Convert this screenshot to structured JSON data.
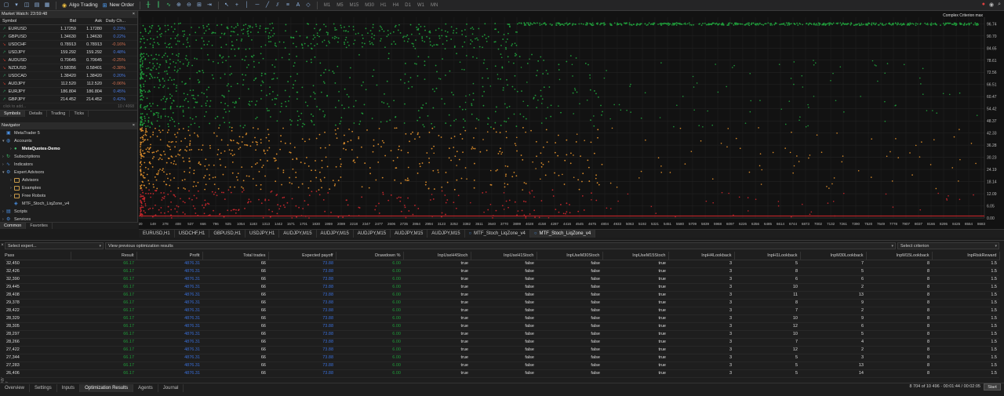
{
  "toolbar": {
    "algo_trading": "Algo Trading",
    "new_order": "New Order",
    "timeframes": [
      "M1",
      "M5",
      "M15",
      "M30",
      "H1",
      "H4",
      "D1",
      "W1",
      "MN"
    ]
  },
  "market_watch": {
    "title": "Market Watch: 23:59:48",
    "columns": [
      "Symbol",
      "Bid",
      "Ask",
      "Daily Ch..."
    ],
    "rows": [
      {
        "symbol": "EURUSD",
        "dir": "up",
        "bid": "1.17259",
        "ask": "1.17280",
        "chg": "0.23%",
        "chg_dir": "up"
      },
      {
        "symbol": "GBPUSD",
        "dir": "up",
        "bid": "1.34630",
        "ask": "1.34630",
        "chg": "0.22%",
        "chg_dir": "up"
      },
      {
        "symbol": "USDCHF",
        "dir": "dn",
        "bid": "0.78913",
        "ask": "0.78913",
        "chg": "-0.16%",
        "chg_dir": "dn"
      },
      {
        "symbol": "USDJPY",
        "dir": "up",
        "bid": "159.292",
        "ask": "159.292",
        "chg": "0.48%",
        "chg_dir": "up"
      },
      {
        "symbol": "AUDUSD",
        "dir": "dn",
        "bid": "0.70645",
        "ask": "0.70645",
        "chg": "-0.25%",
        "chg_dir": "dn"
      },
      {
        "symbol": "NZDUSD",
        "dir": "dn",
        "bid": "0.58356",
        "ask": "0.58401",
        "chg": "-0.38%",
        "chg_dir": "dn"
      },
      {
        "symbol": "USDCAD",
        "dir": "up",
        "bid": "1.38420",
        "ask": "1.38420",
        "chg": "0.20%",
        "chg_dir": "up"
      },
      {
        "symbol": "AUDJPY",
        "dir": "dn",
        "bid": "112.520",
        "ask": "112.520",
        "chg": "-0.06%",
        "chg_dir": "dn"
      },
      {
        "symbol": "EURJPY",
        "dir": "up",
        "bid": "186.804",
        "ask": "186.804",
        "chg": "0.45%",
        "chg_dir": "up"
      },
      {
        "symbol": "GBPJPY",
        "dir": "up",
        "bid": "214.452",
        "ask": "214.452",
        "chg": "0.42%",
        "chg_dir": "up"
      }
    ],
    "footer_left": "click to add...",
    "footer_right": "10 / 4068",
    "tabs": [
      "Symbols",
      "Details",
      "Trading",
      "Ticks"
    ]
  },
  "navigator": {
    "title": "Navigator",
    "items": [
      {
        "label": "MetaTrader 5",
        "level": 0,
        "arrow": "",
        "icon": "terminal-icon"
      },
      {
        "label": "Accounts",
        "level": 0,
        "arrow": "▾",
        "icon": "accounts-icon"
      },
      {
        "label": "MetaQuotes-Demo",
        "level": 1,
        "arrow": "›",
        "icon": "account-icon",
        "bold": true
      },
      {
        "label": "Subscriptions",
        "level": 0,
        "arrow": "›",
        "icon": "subscriptions-icon"
      },
      {
        "label": "Indicators",
        "level": 0,
        "arrow": "›",
        "icon": "indicators-icon"
      },
      {
        "label": "Expert Advisors",
        "level": 0,
        "arrow": "▾",
        "icon": "expert-advisors-icon"
      },
      {
        "label": "Advisors",
        "level": 1,
        "arrow": "›",
        "icon": "folder-icon"
      },
      {
        "label": "Examples",
        "level": 1,
        "arrow": "›",
        "icon": "folder-icon"
      },
      {
        "label": "Free Robots",
        "level": 1,
        "arrow": "›",
        "icon": "folder-icon"
      },
      {
        "label": "MTF_Stoch_LiqZone_v4",
        "level": 1,
        "arrow": "",
        "icon": "expert-icon"
      },
      {
        "label": "Scripts",
        "level": 0,
        "arrow": "›",
        "icon": "scripts-icon"
      },
      {
        "label": "Services",
        "level": 0,
        "arrow": "›",
        "icon": "services-icon"
      }
    ],
    "tabs": [
      "Common",
      "Favorites"
    ]
  },
  "chart": {
    "legend": "Complex Criterion max",
    "y_ticks": [
      "96.74",
      "90.70",
      "84.65",
      "78.61",
      "72.56",
      "66.51",
      "60.47",
      "54.42",
      "48.37",
      "42.33",
      "36.28",
      "30.23",
      "24.19",
      "18.14",
      "12.09",
      "6.05",
      "0.00"
    ],
    "x_ticks": [
      "20",
      "149",
      "278",
      "408",
      "537",
      "666",
      "796",
      "925",
      "1054",
      "1183",
      "1313",
      "1442",
      "1571",
      "1701",
      "1830",
      "1959",
      "2089",
      "2218",
      "2347",
      "2477",
      "2606",
      "2735",
      "2864",
      "2994",
      "3123",
      "3252",
      "3382",
      "3511",
      "3640",
      "3770",
      "3899",
      "4028",
      "4158",
      "4287",
      "4416",
      "4545",
      "4675",
      "4804",
      "4933",
      "5063",
      "5192",
      "5321",
      "5451",
      "5580",
      "5709",
      "5839",
      "5968",
      "6097",
      "6226",
      "6356",
      "6485",
      "6614",
      "6744",
      "6873",
      "7002",
      "7132",
      "7261",
      "7390",
      "7520",
      "7649",
      "7778",
      "7907",
      "8037",
      "8166",
      "8295",
      "8425",
      "8554",
      "8683"
    ],
    "y_range": [
      0,
      100
    ],
    "x_range": [
      20,
      8683
    ]
  },
  "chart_tabs": [
    {
      "label": "EURUSD,H1",
      "icon": ""
    },
    {
      "label": "USDCHF,H1",
      "icon": ""
    },
    {
      "label": "GBPUSD,H1",
      "icon": ""
    },
    {
      "label": "USDJPY,H1",
      "icon": ""
    },
    {
      "label": "AUDJPY,M15",
      "icon": ""
    },
    {
      "label": "AUDJPY,M15",
      "icon": ""
    },
    {
      "label": "AUDJPY,M15",
      "icon": ""
    },
    {
      "label": "AUDJPY,M15",
      "icon": ""
    },
    {
      "label": "AUDJPY,M15",
      "icon": ""
    },
    {
      "label": "MTF_Stoch_LiqZone_v4",
      "icon": "○"
    },
    {
      "label": "MTF_Stoch_LiqZone_v4",
      "icon": "○",
      "active": true
    }
  ],
  "optimization": {
    "select_expert": "Select expert...",
    "view_results": "View previous optimization results",
    "select_criterion": "Select criterion",
    "columns": [
      "Pass",
      "Result",
      "Profit",
      "Total trades",
      "Expected payoff",
      "Drawdown %",
      "InpUseH4Stoch",
      "InpUseH1Stoch",
      "InpUseM30Stoch",
      "InpUseM15Stoch",
      "InpH4Lookback",
      "InpH1Lookback",
      "InpM30Lookback",
      "InpM15Lookback",
      "InpRiskReward"
    ],
    "rows": [
      [
        "32,450",
        "66.17",
        "4876.31",
        "66",
        "73.88",
        "6.00",
        "true",
        "false",
        "false",
        "true",
        "3",
        "5",
        "7",
        "8",
        "1.5"
      ],
      [
        "32,426",
        "66.17",
        "4876.31",
        "66",
        "73.88",
        "6.00",
        "true",
        "false",
        "false",
        "true",
        "3",
        "8",
        "5",
        "8",
        "1.5"
      ],
      [
        "32,390",
        "66.17",
        "4876.31",
        "66",
        "73.88",
        "6.00",
        "true",
        "false",
        "false",
        "true",
        "3",
        "6",
        "6",
        "8",
        "1.5"
      ],
      [
        "29,445",
        "66.17",
        "4876.31",
        "66",
        "73.88",
        "6.00",
        "true",
        "false",
        "false",
        "true",
        "3",
        "10",
        "2",
        "8",
        "1.5"
      ],
      [
        "28,408",
        "66.17",
        "4876.31",
        "66",
        "73.88",
        "6.00",
        "true",
        "false",
        "false",
        "true",
        "3",
        "11",
        "13",
        "8",
        "1.5"
      ],
      [
        "29,378",
        "66.17",
        "4876.31",
        "66",
        "73.88",
        "6.00",
        "true",
        "false",
        "false",
        "true",
        "3",
        "8",
        "9",
        "8",
        "1.5"
      ],
      [
        "28,422",
        "66.17",
        "4876.31",
        "66",
        "73.88",
        "6.00",
        "true",
        "false",
        "false",
        "true",
        "3",
        "7",
        "2",
        "8",
        "1.5"
      ],
      [
        "28,329",
        "66.17",
        "4876.31",
        "66",
        "73.88",
        "6.00",
        "true",
        "false",
        "false",
        "true",
        "3",
        "10",
        "9",
        "8",
        "1.5"
      ],
      [
        "28,305",
        "66.17",
        "4876.31",
        "66",
        "73.88",
        "6.00",
        "true",
        "false",
        "false",
        "true",
        "3",
        "12",
        "6",
        "8",
        "1.5"
      ],
      [
        "28,297",
        "66.17",
        "4876.31",
        "66",
        "73.88",
        "6.00",
        "true",
        "false",
        "false",
        "true",
        "3",
        "10",
        "5",
        "8",
        "1.5"
      ],
      [
        "28,266",
        "66.17",
        "4876.31",
        "66",
        "73.88",
        "6.00",
        "true",
        "false",
        "false",
        "true",
        "3",
        "7",
        "4",
        "8",
        "1.5"
      ],
      [
        "27,422",
        "66.17",
        "4876.31",
        "66",
        "73.88",
        "6.00",
        "true",
        "false",
        "false",
        "true",
        "3",
        "12",
        "2",
        "8",
        "1.5"
      ],
      [
        "27,344",
        "66.17",
        "4876.31",
        "66",
        "73.88",
        "6.00",
        "true",
        "false",
        "false",
        "true",
        "3",
        "5",
        "3",
        "8",
        "1.5"
      ],
      [
        "27,283",
        "66.17",
        "4876.31",
        "66",
        "73.88",
        "6.00",
        "true",
        "false",
        "false",
        "true",
        "3",
        "5",
        "13",
        "8",
        "1.5"
      ],
      [
        "26,406",
        "66.17",
        "4876.31",
        "66",
        "73.88",
        "6.00",
        "true",
        "false",
        "false",
        "true",
        "3",
        "5",
        "14",
        "8",
        "1.5"
      ]
    ]
  },
  "side_label": "Strategy Tester",
  "bottom_tabs": [
    "Overview",
    "Settings",
    "Inputs",
    "Optimization Results",
    "Agents",
    "Journal"
  ],
  "status_text": "8 704 of 10 496 · 00:01:44 / 00:02:05",
  "start_label": "Start",
  "colors": {
    "green": "#1f9a3a",
    "orange": "#d98b2b",
    "red": "#c0262b",
    "blue": "#3a6fd8"
  }
}
